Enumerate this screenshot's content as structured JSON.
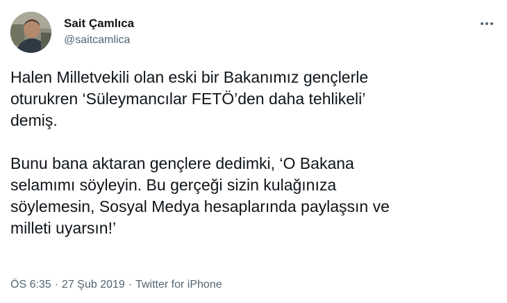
{
  "author": {
    "display_name": "Sait Çamlıca",
    "handle": "@saitcamlica"
  },
  "menu_icon": "more-horizontal-icon",
  "tweet": {
    "paragraphs": [
      "Halen Milletvekili olan eski bir Bakanımız gençlerle\noturukren ‘Süleymancılar FETÖ’den daha tehlikeli’\ndemiş.",
      "Bunu bana aktaran gençlere dedimki, ‘O Bakana\nselamımı söyleyin. Bu gerçeği sizin kulağınıza\nsöylemesin, Sosyal Medya hesaplarında paylaşsın ve\nmilleti uyarsın!’"
    ]
  },
  "meta": {
    "time": "ÖS 6:35",
    "date": "27 Şub 2019",
    "source": "Twitter for iPhone",
    "separator": "·"
  },
  "colors": {
    "text": "#0f1419",
    "secondary": "#536471"
  }
}
